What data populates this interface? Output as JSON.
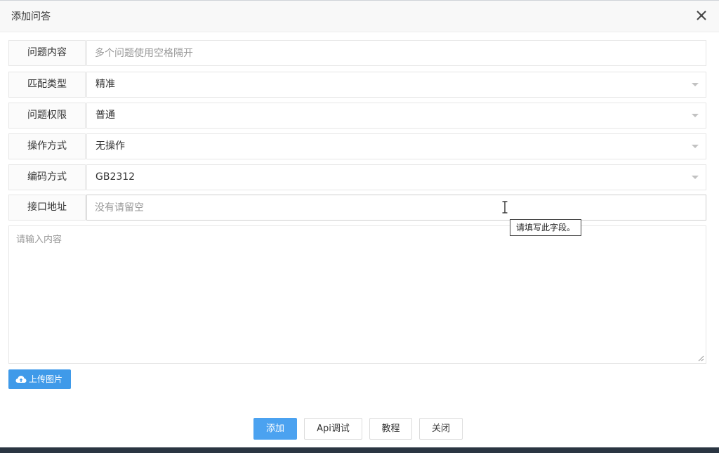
{
  "dialog": {
    "title": "添加问答"
  },
  "form": {
    "question": {
      "label": "问题内容",
      "placeholder": "多个问题使用空格隔开",
      "value": ""
    },
    "match_type": {
      "label": "匹配类型",
      "value": "精准"
    },
    "permission": {
      "label": "问题权限",
      "value": "普通"
    },
    "operation": {
      "label": "操作方式",
      "value": "无操作"
    },
    "encoding": {
      "label": "编码方式",
      "value": "GB2312"
    },
    "api_url": {
      "label": "接口地址",
      "placeholder": "没有请留空",
      "value": ""
    },
    "content": {
      "placeholder": "请输入内容",
      "value": ""
    }
  },
  "tooltip": {
    "text": "请填写此字段。"
  },
  "upload": {
    "label": "上传图片",
    "icon": "cloud-upload-icon"
  },
  "footer": {
    "add_label": "添加",
    "api_test_label": "Api调试",
    "tutorial_label": "教程",
    "close_label": "关闭"
  },
  "colors": {
    "primary": "#4ba2f0",
    "upload_button": "#3f9ae9",
    "border": "#e6e6e6",
    "label_bg": "#fbfbfb",
    "placeholder": "#999999"
  }
}
